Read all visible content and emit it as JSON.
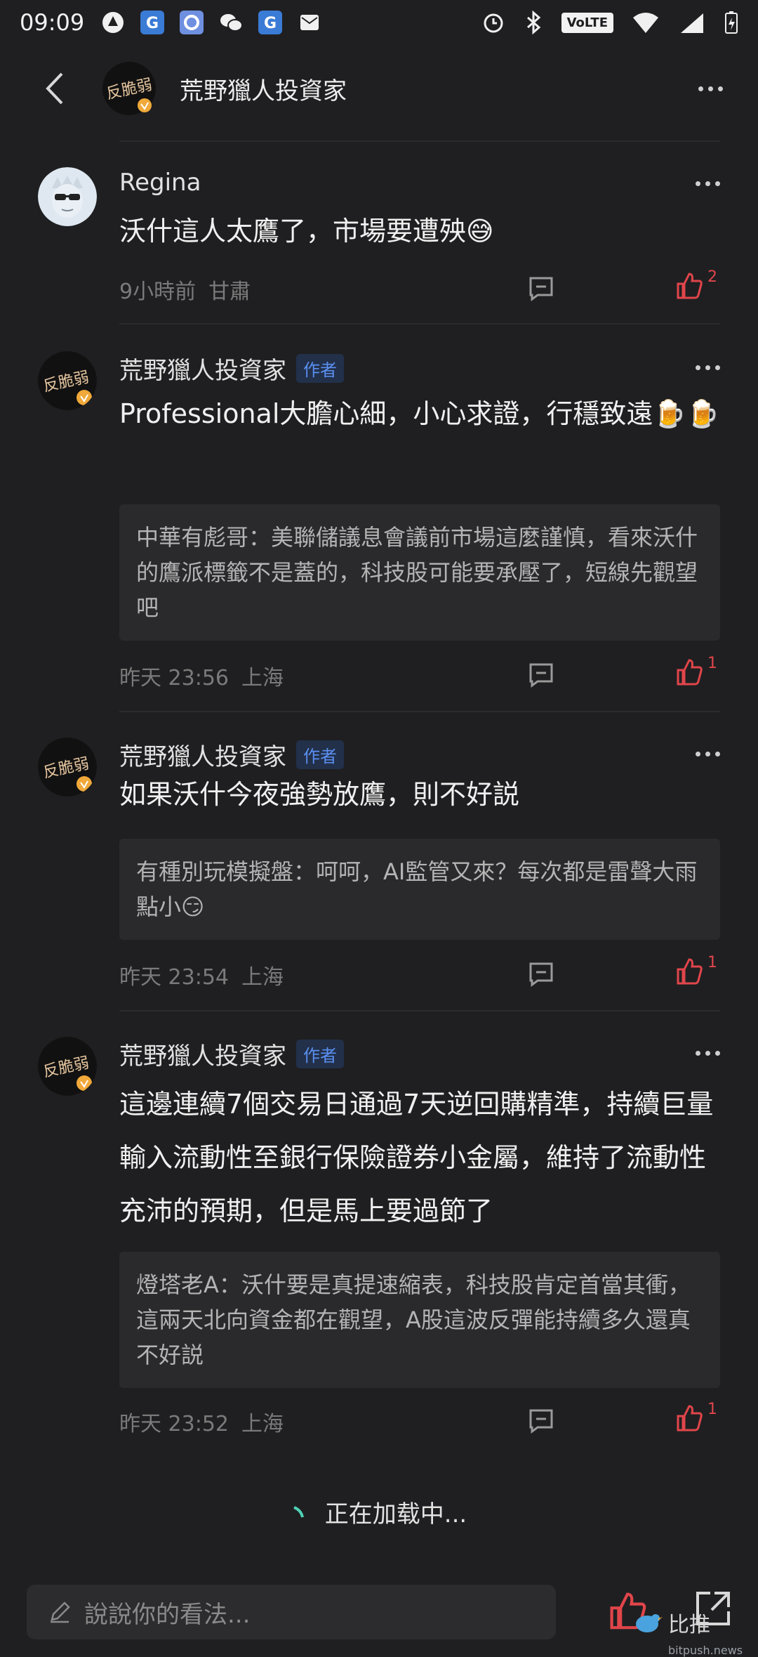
{
  "status": {
    "time": "09:09",
    "volte": "VoLTE",
    "signal_x": "x"
  },
  "header": {
    "title": "荒野獵人投資家",
    "avatar_text": "反脆弱"
  },
  "comments": [
    {
      "name": "Regina",
      "text": "沃什這人太鷹了，市場要遭殃😅",
      "time": "9小時前",
      "location": "甘肅",
      "likes": "2"
    },
    {
      "name": "荒野獵人投資家",
      "badge": "作者",
      "text": "Professional大膽心細，小心求證，行穩致遠🍺🍺",
      "quote": "中華有彪哥：美聯儲議息會議前市場這麼謹慎，看來沃什的鷹派標籤不是蓋的，科技股可能要承壓了，短線先觀望吧",
      "time": "昨天 23:56",
      "location": "上海",
      "likes": "1"
    },
    {
      "name": "荒野獵人投資家",
      "badge": "作者",
      "text": "如果沃什今夜強勢放鷹，則不好説",
      "quote": "有種別玩模擬盤：呵呵，AI監管又來？每次都是雷聲大雨點小😏",
      "time": "昨天 23:54",
      "location": "上海",
      "likes": "1"
    },
    {
      "name": "荒野獵人投資家",
      "badge": "作者",
      "text": "這邊連續7個交易日通過7天逆回購精準，持續巨量輸入流動性至銀行保險證券小金屬，維持了流動性充沛的預期，但是馬上要過節了",
      "quote": "燈塔老A：沃什要是真提速縮表，科技股肯定首當其衝，這兩天北向資金都在觀望，A股這波反彈能持續多久還真不好説",
      "time": "昨天 23:52",
      "location": "上海",
      "likes": "1"
    }
  ],
  "loading": "正在加载中...",
  "composer": {
    "placeholder": "說說你的看法..."
  },
  "watermark": {
    "text": "比推",
    "sub": "bitpush.news"
  },
  "colors": {
    "background": "#1f1f21",
    "like_red": "#e0454a",
    "author_badge": "#5b8ff0"
  }
}
